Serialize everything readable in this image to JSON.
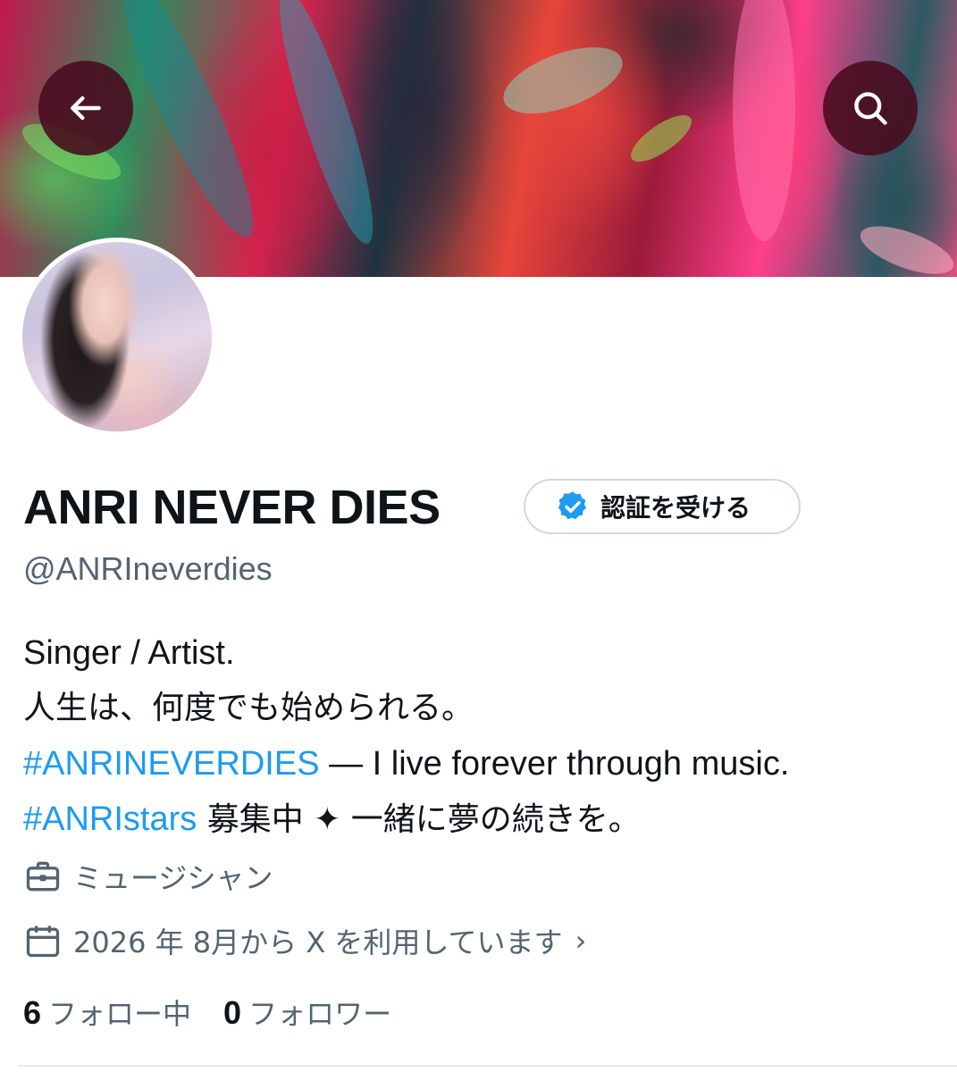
{
  "header": {
    "back_icon": "arrow-left-icon",
    "search_icon": "search-icon",
    "button_bg": "#480a1e"
  },
  "profile": {
    "display_name": "ANRI NEVER DIES",
    "verify_label": "認証を受ける",
    "verify_icon": "verified-badge-icon",
    "verify_color": "#1d9bf0",
    "handle": "@ANRIneverdies"
  },
  "bio": {
    "line1": "Singer / Artist.",
    "line2": "人生は、何度でも始められる。",
    "line3_tag": "#ANRINEVERDIES",
    "line3_text": " — I live forever through music.",
    "line4_tag": "#ANRIstars",
    "line4_text": " 募集中 ✦ 一緒に夢の続きを。",
    "hashtag_color": "#1d9bf0"
  },
  "meta": {
    "job_icon": "briefcase-icon",
    "job": "ミュージシャン",
    "calendar_icon": "calendar-icon",
    "joined": "2026 年 8月から X を利用しています",
    "chevron": "›"
  },
  "stats": {
    "following_count": "6",
    "following_label": "フォロー中",
    "followers_count": "0",
    "followers_label": "フォロワー"
  }
}
